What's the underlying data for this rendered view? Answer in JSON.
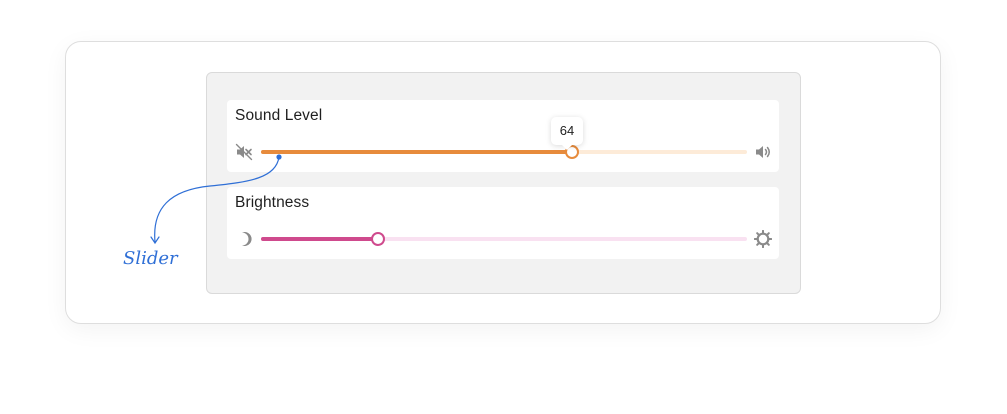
{
  "sliders": [
    {
      "title": "Sound Level",
      "value": 64,
      "fraction": 0.64,
      "tooltip": "64",
      "left_icon": "volume-mute-icon",
      "right_icon": "volume-up-icon",
      "fill_color": "#e78b3c",
      "track_color": "#fdebd8"
    },
    {
      "title": "Brightness",
      "value": 24,
      "fraction": 0.24,
      "left_icon": "moon-icon",
      "right_icon": "sun-icon",
      "fill_color": "#cf4a8d",
      "track_color": "#f9e1f1"
    }
  ],
  "annotation": {
    "label": "Slider",
    "color": "#2f6fd6"
  }
}
